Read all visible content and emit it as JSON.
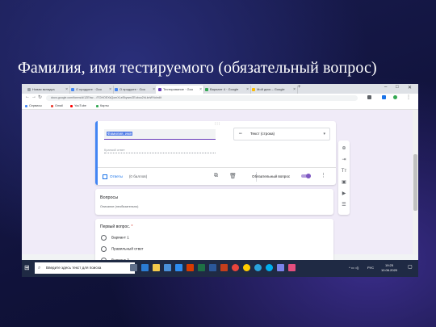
{
  "slide": {
    "title": "Фамилия, имя тестируемого (обязательный вопрос)"
  },
  "browser": {
    "tabs": [
      {
        "label": "Новая вкладка",
        "color": "#9aa0a6"
      },
      {
        "label": "О продукте · Goo",
        "color": "#4285f4"
      },
      {
        "label": "О продукте · Goo",
        "color": "#4285f4"
      },
      {
        "label": "Тестирование · Goo",
        "color": "#673ab7",
        "active": true
      },
      {
        "label": "Вариант 4 · Google",
        "color": "#34a853"
      },
      {
        "label": "Мой диск – Google",
        "color": "#fbbc04"
      }
    ],
    "new_tab": "+",
    "window_controls": {
      "minimize": "–",
      "maximize": "□",
      "close": "✕"
    },
    "url": "docs.google.com/forms/d/1ZEhw-...fTOHOEXkQomXLeEkywmZEuboo2hLkeWYo/edit",
    "bookmarks": [
      {
        "label": "Сервисы",
        "color": "#4285f4"
      },
      {
        "label": "Gmail",
        "color": "#ea4335"
      },
      {
        "label": "YouTube",
        "color": "#ff0000"
      },
      {
        "label": "Карты",
        "color": "#34a853"
      }
    ]
  },
  "form": {
    "question_title": "Фамилия, имя",
    "question_type": "Текст (строка)",
    "short_answer_placeholder": "Краткий ответ",
    "answers_label": "Ответы",
    "points_label": "(0 баллов)",
    "required_label": "Обязательный вопрос",
    "required_on": true,
    "section_title": "Вопросы",
    "section_desc": "Описание (необязательно)",
    "mc_question": "Первый вопрос.",
    "mc_required_mark": "*",
    "options": [
      "Вариант 1",
      "Правильный ответ",
      "Вариант 3"
    ],
    "accent_color": "#673ab7",
    "side_toolbar": [
      "add-question",
      "import-questions",
      "add-title",
      "add-image",
      "add-video",
      "add-section"
    ]
  },
  "taskbar": {
    "search_placeholder": "Введите здесь текст для поиска",
    "apps": [
      {
        "name": "task-view",
        "color": "#5f6f8a"
      },
      {
        "name": "edge",
        "color": "#2b7cd3"
      },
      {
        "name": "explorer",
        "color": "#f2c94c"
      },
      {
        "name": "store",
        "color": "#4a90d9"
      },
      {
        "name": "mail",
        "color": "#2d8cf0"
      },
      {
        "name": "office",
        "color": "#d83b01"
      },
      {
        "name": "excel",
        "color": "#1e7145"
      },
      {
        "name": "word",
        "color": "#2b579a"
      },
      {
        "name": "powerpoint",
        "color": "#c43e1c"
      },
      {
        "name": "chrome",
        "color": "#e8453c"
      },
      {
        "name": "yandex",
        "color": "#ffcc00"
      },
      {
        "name": "telegram",
        "color": "#2aa3dc"
      },
      {
        "name": "skype",
        "color": "#00aff0"
      },
      {
        "name": "files",
        "color": "#7b83eb"
      },
      {
        "name": "paint",
        "color": "#e34e7e"
      }
    ],
    "lang": "РУС",
    "time": "19:25",
    "date": "10.06.2020"
  }
}
